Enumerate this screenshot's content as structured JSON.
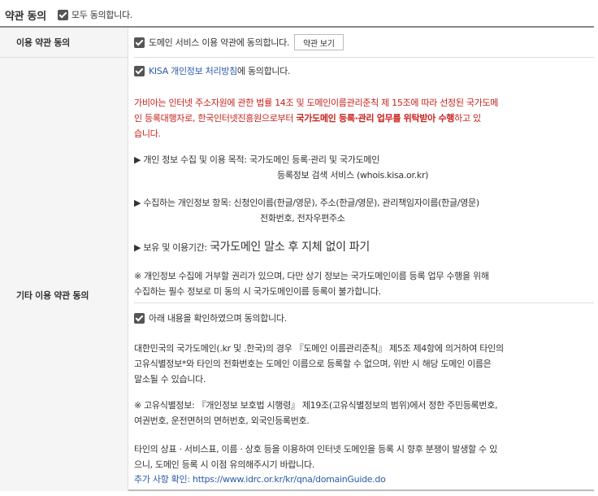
{
  "header": {
    "title": "약관 동의",
    "agree_all_label": "모두 동의합니다."
  },
  "rows": {
    "terms": {
      "label": "이용 약관 동의",
      "checkbox_label": "도메인 서비스 이용 약관에 동의합니다.",
      "button_label": "약관 보기"
    },
    "other": {
      "label": "기타 이용 약관 동의",
      "privacy": {
        "link_text": "KISA 개인정보 처리방침",
        "suffix": "에 동의합니다.",
        "red_1": "가비아는 인터넷 주소자원에 관한 법률 14조 및 도메인이름관리준칙 제 15조에 따라 선정된 국가도메",
        "red_2_pre": "인 등록대행자로, 한국인터넷진흥원으로부터 ",
        "red_2_bold": "국가도메인 등록·관리 업무를 위탁받아 수행",
        "red_2_post": "하고 있",
        "red_3": "습니다.",
        "purpose_1": "▶ 개인 정보 수집 및 이용 목적:  국가도메인 등록·관리 및 국가도메인",
        "purpose_2": "등록정보 검색 서비스 (whois.kisa.or.kr)",
        "items_1": "▶ 수집하는 개인정보 항목:  신청인이름(한글/영문), 주소(한글/영문), 관리책임자이름(한글/영문)",
        "items_2": "전화번호, 전자우편주소",
        "retention_label": "▶ 보유 및 이용기간: ",
        "retention_value": "국가도메인 말소 후 지체 없이 파기",
        "note_1": "※ 개인정보 수집에 거부할 권리가 있으며, 다만 상기 정보는 국가도메인이름 등록 업무 수행을 위해",
        "note_2": "수집하는 필수 정보로 미 동의 시 국가도메인이름 등록이 불가합니다."
      },
      "confirm": {
        "checkbox_label": "아래 내용을 확인하였으며 동의합니다.",
        "p1_1": "대한민국의 국가도메인(.kr 및 .한국)의 경우 『도메인 이름관리준칙』 제5조 제4항에 의거하여 타인의",
        "p1_2": "고유식별정보*와 타인의 전화번호는 도메인 이름으로 등록할 수 없으며, 위반 시 해당 도메인 이름은",
        "p1_3": "말소될 수 있습니다.",
        "p2_1": "※ 고유식별정보: 『개인정보 보호법 시행령』 제19조(고유식별정보의 범위)에서 정한 주민등록번호,",
        "p2_2": "여권번호, 운전면허의 면허번호, 외국인등록번호.",
        "p3_1": "타인의 상표 · 서비스표, 이름 · 상호 등을 이용하여 인터넷 도메인을 등록 시 향후 분쟁이 발생할 수 있",
        "p3_2": "으니, 도메인 등록 시 이점 유의해주시기 바랍니다.",
        "more": "추가 사항 확인: https://www.idrc.or.kr/kr/qna/domainGuide.do"
      }
    }
  }
}
